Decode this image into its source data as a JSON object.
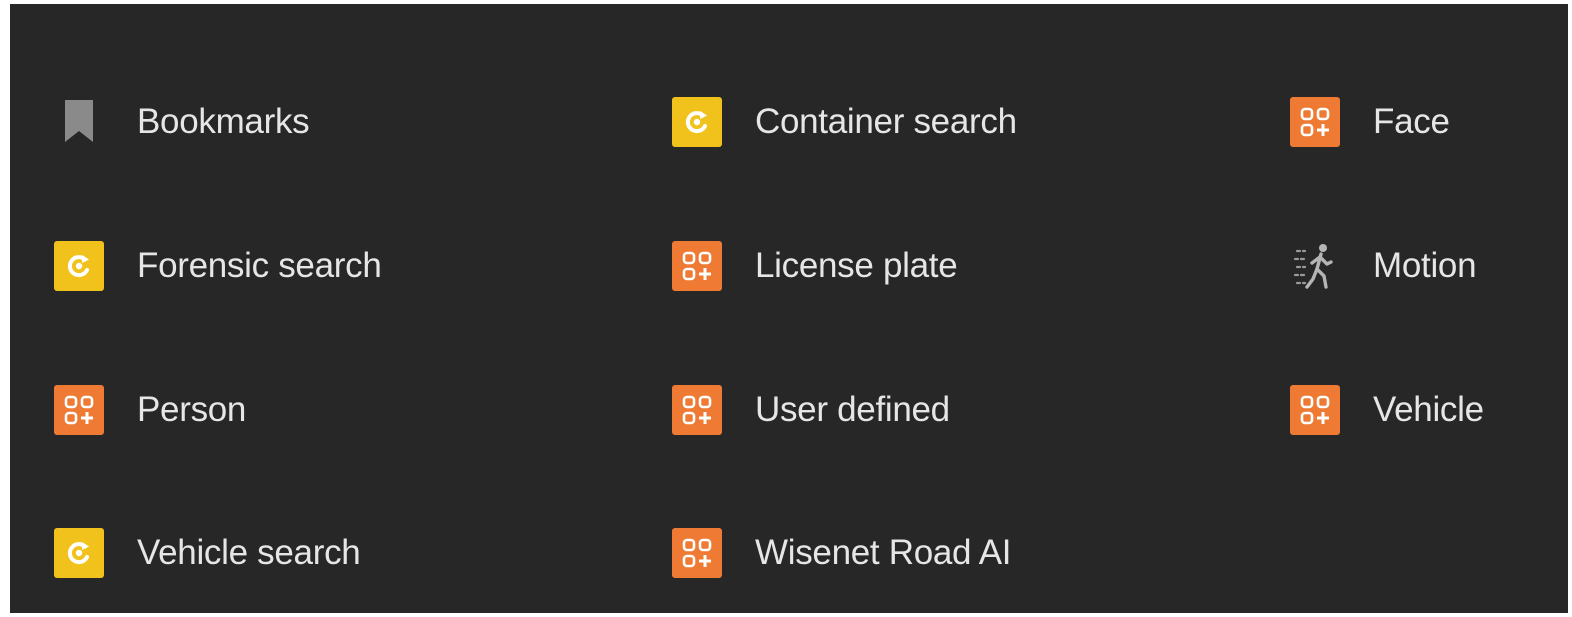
{
  "items": [
    {
      "label": "Bookmarks",
      "icon": "bookmark-icon"
    },
    {
      "label": "Container search",
      "icon": "search-plugin-icon"
    },
    {
      "label": "Face",
      "icon": "ai-object-icon"
    },
    {
      "label": "Forensic search",
      "icon": "search-plugin-icon"
    },
    {
      "label": "License plate",
      "icon": "ai-object-icon"
    },
    {
      "label": "Motion",
      "icon": "motion-icon"
    },
    {
      "label": "Person",
      "icon": "ai-object-icon"
    },
    {
      "label": "User defined",
      "icon": "ai-object-icon"
    },
    {
      "label": "Vehicle",
      "icon": "ai-object-icon"
    },
    {
      "label": "Vehicle search",
      "icon": "search-plugin-icon"
    },
    {
      "label": "Wisenet Road AI",
      "icon": "ai-object-icon"
    }
  ],
  "colors": {
    "background": "#272727",
    "text": "#e6e6e6",
    "search_plugin_tile": "#f2c21c",
    "ai_object_tile": "#ee7a34",
    "bookmark": "#8a8a8a"
  }
}
